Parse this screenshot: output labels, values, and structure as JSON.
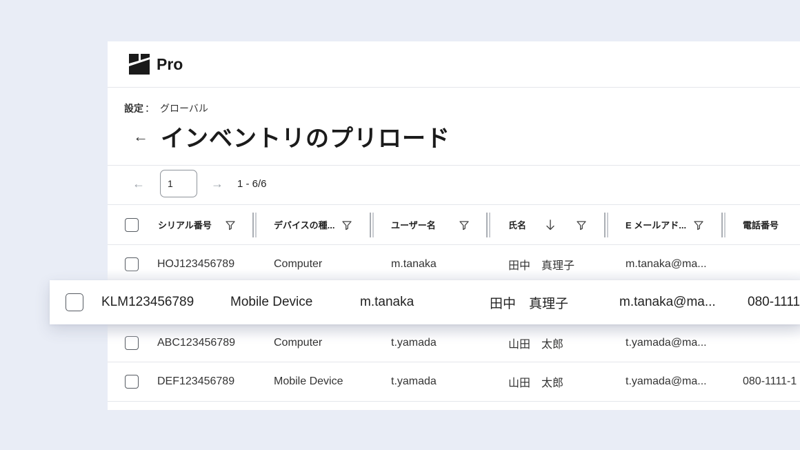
{
  "app": {
    "brand": "Pro"
  },
  "breadcrumb": {
    "label": "設定",
    "separator": "：",
    "current": "グローバル"
  },
  "page": {
    "back_icon": "←",
    "title": "インベントリのプリロード"
  },
  "pagination": {
    "prev_icon": "←",
    "page": "1",
    "next_icon": "→",
    "range": "1 - 6/6"
  },
  "table": {
    "columns": [
      {
        "label": "シリアル番号"
      },
      {
        "label": "デバイスの種..."
      },
      {
        "label": "ユーザー名"
      },
      {
        "label": "氏名"
      },
      {
        "label": "E メールアド..."
      },
      {
        "label": "電話番号"
      }
    ],
    "rows": [
      {
        "serial": "HOJ123456789",
        "type": "Computer",
        "user": "m.tanaka",
        "name": "田中　真理子",
        "email": "m.tanaka@ma...",
        "phone": ""
      },
      {
        "serial": "ABC123456789",
        "type": "Computer",
        "user": "t.yamada",
        "name": "山田　太郎",
        "email": "t.yamada@ma...",
        "phone": ""
      },
      {
        "serial": "DEF123456789",
        "type": "Mobile Device",
        "user": "t.yamada",
        "name": "山田　太郎",
        "email": "t.yamada@ma...",
        "phone": "080-1111-1"
      }
    ],
    "dragged_row": {
      "serial": "KLM123456789",
      "type": "Mobile Device",
      "user": "m.tanaka",
      "name": "田中　真理子",
      "email": "m.tanaka@ma...",
      "phone": "080-1111"
    }
  }
}
